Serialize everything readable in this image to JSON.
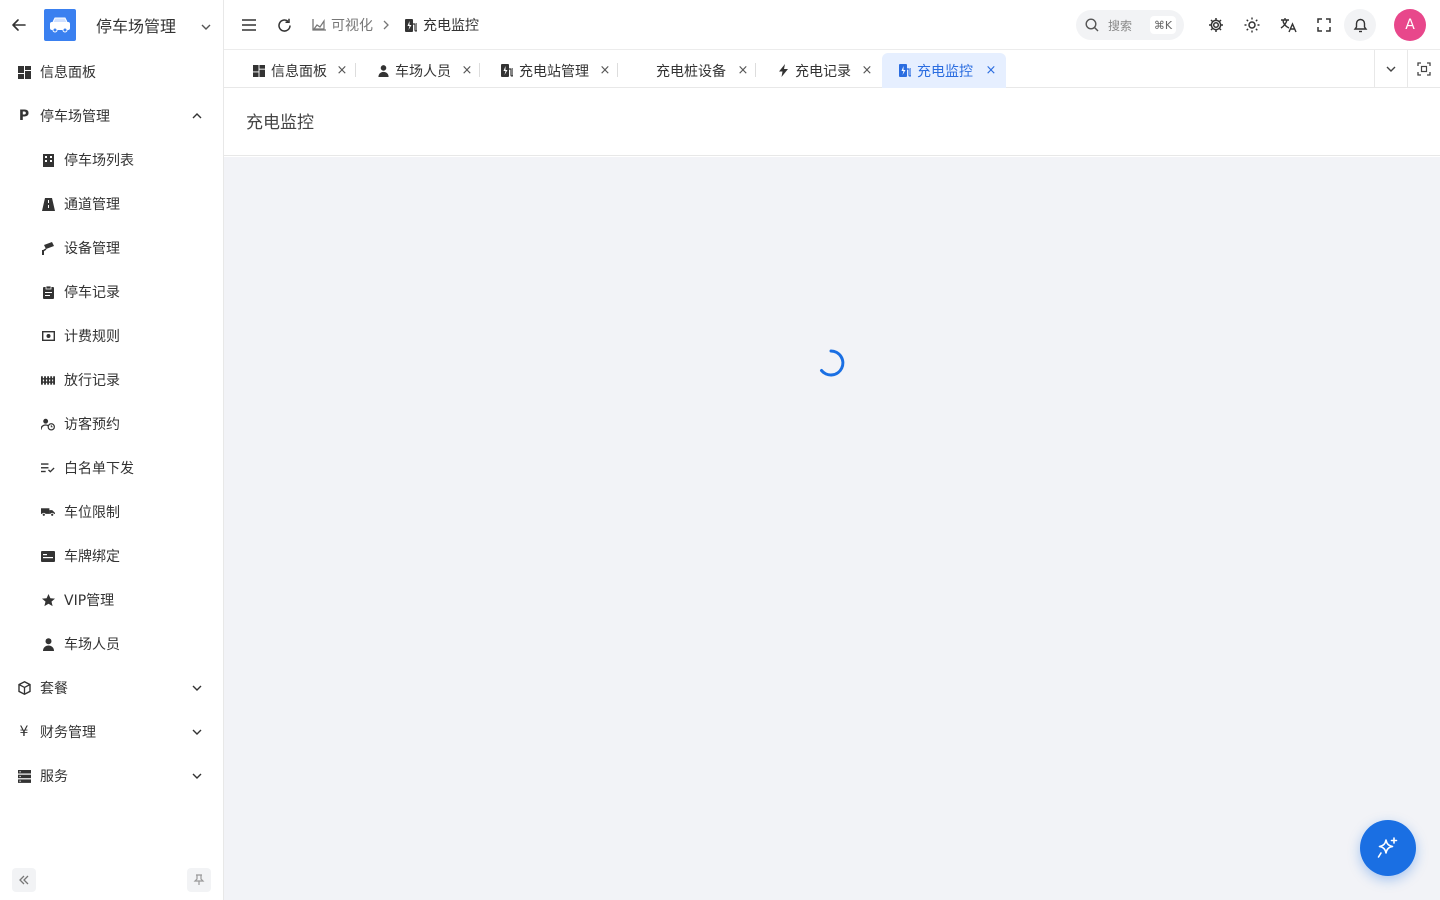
{
  "sidebar": {
    "title": "停车场管理",
    "items": [
      {
        "label": "信息面板"
      },
      {
        "label": "停车场管理"
      },
      {
        "label": "停车场列表"
      },
      {
        "label": "通道管理"
      },
      {
        "label": "设备管理"
      },
      {
        "label": "停车记录"
      },
      {
        "label": "计费规则"
      },
      {
        "label": "放行记录"
      },
      {
        "label": "访客预约"
      },
      {
        "label": "白名单下发"
      },
      {
        "label": "车位限制"
      },
      {
        "label": "车牌绑定"
      },
      {
        "label": "VIP管理"
      },
      {
        "label": "车场人员"
      },
      {
        "label": "套餐"
      },
      {
        "label": "财务管理"
      },
      {
        "label": "服务"
      }
    ]
  },
  "header": {
    "breadcrumb": [
      "可视化",
      "充电监控"
    ],
    "search": {
      "placeholder": "搜索",
      "shortcut": "⌘K"
    },
    "avatar_letter": "A"
  },
  "tabs": [
    {
      "label": "信息面板"
    },
    {
      "label": "车场人员"
    },
    {
      "label": "充电站管理"
    },
    {
      "label": "充电桩设备"
    },
    {
      "label": "充电记录"
    },
    {
      "label": "充电监控"
    }
  ],
  "page": {
    "title": "充电监控"
  },
  "colors": {
    "accent": "#1a6fe3",
    "active_tab_bg": "#e6efff",
    "avatar": "#e8478b",
    "content_bg": "#f2f3f7"
  }
}
